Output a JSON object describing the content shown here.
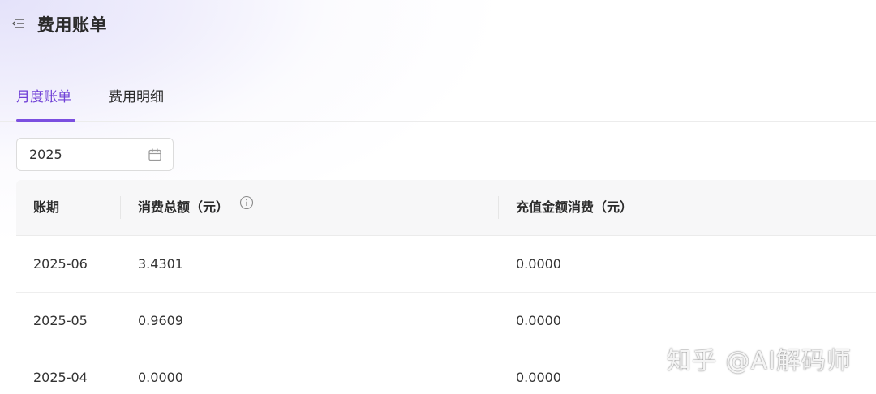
{
  "header": {
    "menu_icon": "menu-collapse-icon",
    "title": "费用账单"
  },
  "tabs": [
    {
      "label": "月度账单",
      "active": true
    },
    {
      "label": "费用明细",
      "active": false
    }
  ],
  "filters": {
    "year_value": "2025",
    "calendar_icon": "calendar-icon"
  },
  "table": {
    "columns": [
      {
        "label": "账期"
      },
      {
        "label": "消费总额（元）",
        "info_icon": "info-icon"
      },
      {
        "label": "充值金额消费（元）"
      }
    ],
    "rows": [
      {
        "period": "2025-06",
        "total": "3.4301",
        "recharge": "0.0000"
      },
      {
        "period": "2025-05",
        "total": "0.9609",
        "recharge": "0.0000"
      },
      {
        "period": "2025-04",
        "total": "0.0000",
        "recharge": "0.0000"
      }
    ]
  },
  "watermark": "知乎 @AI解码师",
  "colors": {
    "accent": "#7b4fe0",
    "active_tab_text": "#7040d6",
    "header_bg": "#f7f7f8"
  }
}
